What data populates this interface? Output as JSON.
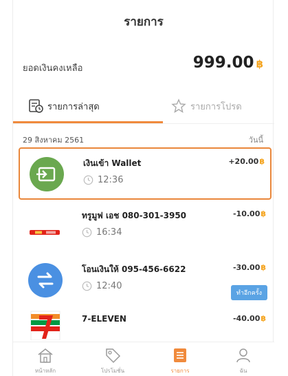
{
  "header": {
    "title": "รายการ"
  },
  "balance": {
    "label": "ยอดเงินคงเหลือ",
    "amount": "999.00",
    "currency": "฿"
  },
  "tabs": [
    {
      "label": "รายการล่าสุด",
      "active": true
    },
    {
      "label": "รายการโปรด",
      "active": false
    }
  ],
  "date_row": {
    "date": "29 สิงหาคม 2561",
    "day": "วันนี้"
  },
  "transactions": [
    {
      "title": "เงินเข้า Wallet",
      "time": "12:36",
      "amount": "+20.00",
      "icon": "wallet-in-icon"
    },
    {
      "title": "ทรูมูฟ เอช 080-301-3950",
      "time": "16:34",
      "amount": "-10.00",
      "icon": "truemove-logo-icon"
    },
    {
      "title": "โอนเงินให้ 095-456-6622",
      "time": "12:40",
      "amount": "-30.00",
      "icon": "transfer-icon",
      "action": "ทำอีกครั้ง"
    },
    {
      "title": "7-ELEVEN",
      "time": "",
      "amount": "-40.00",
      "icon": "seven-eleven-logo-icon"
    }
  ],
  "navbar": {
    "items": [
      {
        "label": "หน้าหลัก",
        "icon": "home-icon",
        "active": false
      },
      {
        "label": "โปรโมชั่น",
        "icon": "tag-icon",
        "active": false
      },
      {
        "label": "รายการ",
        "icon": "list-icon",
        "active": true
      },
      {
        "label": "ฉัน",
        "icon": "user-icon",
        "active": false
      }
    ]
  },
  "colors": {
    "accent": "#f08a3c",
    "baht": "#f5a623",
    "wallet_green": "#6aa84f",
    "transfer_blue": "#4a90e2",
    "pill_blue": "#5aa3e4"
  }
}
